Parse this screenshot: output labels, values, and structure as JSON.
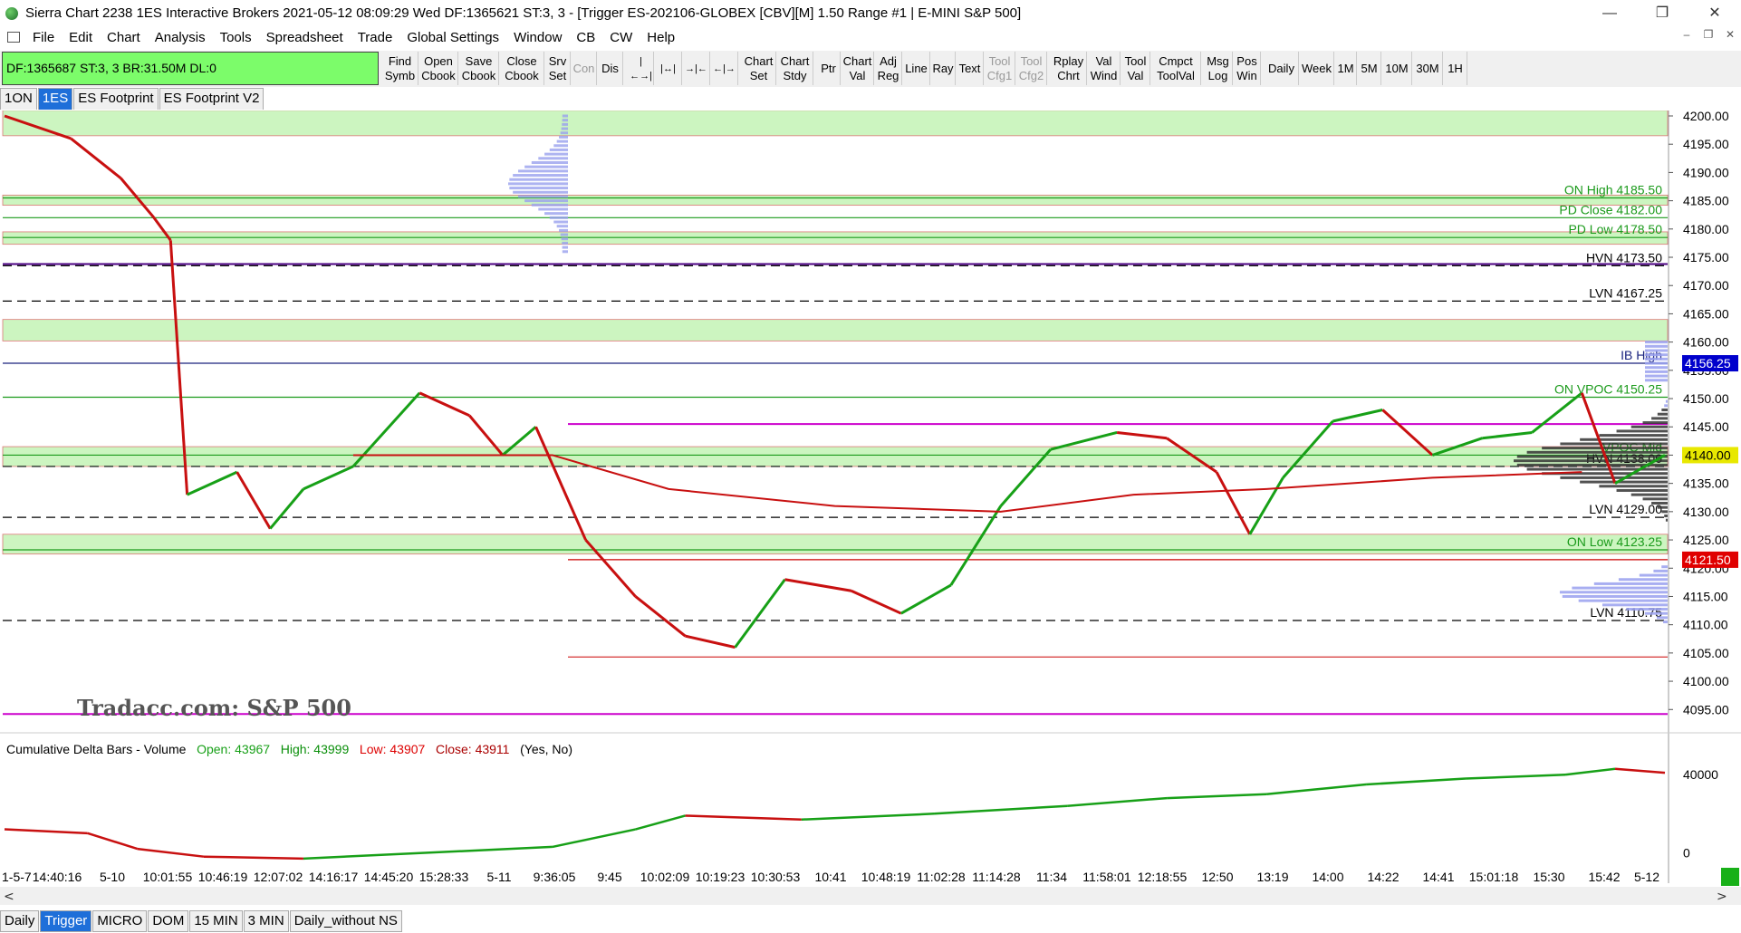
{
  "window": {
    "title": "Sierra Chart 2238 1ES  Interactive Brokers 2021-05-12  08:09:29 Wed  DF:1365621  ST:3, 3 - [Trigger ES-202106-GLOBEX [CBV][M]  1.50 Range  #1 | E-MINI S&P 500]",
    "minimize": "—",
    "restore": "❐",
    "close": "✕"
  },
  "menu": [
    "File",
    "Edit",
    "Chart",
    "Analysis",
    "Tools",
    "Spreadsheet",
    "Trade",
    "Global Settings",
    "Window",
    "CB",
    "CW",
    "Help"
  ],
  "mdi": {
    "minimize": "–",
    "restore": "❐",
    "close": "✕"
  },
  "status": "DF:1365687  ST:3, 3   BR:31.50M  DL:0",
  "toolbar": {
    "find": "Find\nSymb",
    "open": "Open\nCbook",
    "save": "Save\nCbook",
    "close_cb": "Close\nCbook",
    "srv": "Srv\nSet",
    "con": "Con",
    "dis": "Dis",
    "i1": "|←→|",
    "i2": "|↔|",
    "i3": "→|←",
    "i4": "←|→",
    "chart_set": "Chart\nSet",
    "chart_stdy": "Chart\nStdy",
    "ptr": "Ptr",
    "chart_val": "Chart\nVal",
    "adj_reg": "Adj\nReg",
    "line": "Line",
    "ray": "Ray",
    "text": "Text",
    "tool_cfg1": "Tool\nCfg1",
    "tool_cfg2": "Tool\nCfg2",
    "rplay": "Rplay\nChrt",
    "val_wind": "Val\nWind",
    "tool_val": "Tool\nVal",
    "cmpct": "Cmpct\nToolVal",
    "msg": "Msg\nLog",
    "pos": "Pos\nWin",
    "daily": "Daily",
    "week": "Week",
    "m1": "1M",
    "m5": "5M",
    "m10": "10M",
    "m30": "30M",
    "h1": "1H"
  },
  "chart_tabs": [
    "1ON",
    "1ES",
    "ES Footprint",
    "ES Footprint V2"
  ],
  "bottom_tabs": [
    "Daily",
    "Trigger",
    "MICRO",
    "DOM",
    "15 MIN",
    "3 MIN",
    "Daily_without NS"
  ],
  "watermark": "Tradacc.com: S&P 500",
  "delta": {
    "label": "Cumulative Delta Bars - Volume",
    "open": "Open: 43967",
    "high": "High: 43999",
    "low": "Low: 43907",
    "close": "Close: 43911",
    "flags": "(Yes, No)"
  },
  "colors": {
    "green_band": "#ccf5c0",
    "purple": "#cc00cc",
    "red": "#cc0000",
    "navy": "#1a237e",
    "price_bg": "#0000cc",
    "low_bg": "#e00000"
  },
  "chart_data": [
    {
      "type": "line",
      "title": "",
      "price_axis": {
        "ticks": [
          4200,
          4195,
          4190,
          4185,
          4180,
          4175,
          4170,
          4165,
          4160,
          4155,
          4150,
          4145,
          4140,
          4135,
          4130,
          4125,
          4120,
          4115,
          4110,
          4105,
          4100,
          4095
        ],
        "tick_labels": [
          "4200.00",
          "4195.00",
          "4190.00",
          "4185.00",
          "4180.00",
          "4175.00",
          "4170.00",
          "4165.00",
          "4160.00",
          "4155.00",
          "4150.00",
          "4145.00",
          "4140.00",
          "4135.00",
          "4130.00",
          "4125.00",
          "4120.00",
          "4115.00",
          "4110.00",
          "4105.00",
          "4100.00",
          "4095.00"
        ],
        "range": [
          4092,
          4200
        ]
      },
      "levels": [
        {
          "label": "ON High  4185.50",
          "price": 4185.5,
          "color": "#1a9a1a"
        },
        {
          "label": "PD Close  4182.00",
          "price": 4182.0,
          "color": "#1a9a1a"
        },
        {
          "label": "PD Low  4178.50",
          "price": 4178.5,
          "color": "#1a9a1a"
        },
        {
          "label": "HVN  4173.50",
          "price": 4173.5,
          "color": "#000"
        },
        {
          "label": "LVN  4167.25",
          "price": 4167.25,
          "color": "#000"
        },
        {
          "label": "IB High",
          "price": 4156.25,
          "color": "#1a237e"
        },
        {
          "label": "ON VPOC  4150.25",
          "price": 4150.25,
          "color": "#1a9a1a"
        },
        {
          "label": "VPOC Mid",
          "price": 4140.0,
          "color": "#1a9a1a"
        },
        {
          "label": "HVN  4138.00",
          "price": 4138.0,
          "color": "#000"
        },
        {
          "label": "LVN  4129.00",
          "price": 4129.0,
          "color": "#000"
        },
        {
          "label": "ON Low  4123.25",
          "price": 4123.25,
          "color": "#1a9a1a"
        },
        {
          "label": "LVN  4110.75",
          "price": 4110.75,
          "color": "#000"
        }
      ],
      "price_tags": [
        {
          "label": "4156.25",
          "price": 4156.25,
          "color": "#0000cc"
        },
        {
          "label": "4140.00",
          "price": 4140.0,
          "color": "#e8e800"
        },
        {
          "label": "4121.50",
          "price": 4121.5,
          "color": "#e00000"
        }
      ],
      "price_path": [
        {
          "t": 0.0,
          "p": 4200
        },
        {
          "t": 0.04,
          "p": 4196
        },
        {
          "t": 0.07,
          "p": 4189
        },
        {
          "t": 0.09,
          "p": 4182
        },
        {
          "t": 0.1,
          "p": 4178
        },
        {
          "t": 0.11,
          "p": 4133
        },
        {
          "t": 0.14,
          "p": 4137
        },
        {
          "t": 0.16,
          "p": 4127
        },
        {
          "t": 0.18,
          "p": 4134
        },
        {
          "t": 0.21,
          "p": 4138
        },
        {
          "t": 0.25,
          "p": 4151
        },
        {
          "t": 0.28,
          "p": 4147
        },
        {
          "t": 0.3,
          "p": 4140
        },
        {
          "t": 0.32,
          "p": 4145
        },
        {
          "t": 0.35,
          "p": 4125
        },
        {
          "t": 0.38,
          "p": 4115
        },
        {
          "t": 0.41,
          "p": 4108
        },
        {
          "t": 0.44,
          "p": 4106
        },
        {
          "t": 0.47,
          "p": 4118
        },
        {
          "t": 0.51,
          "p": 4116
        },
        {
          "t": 0.54,
          "p": 4112
        },
        {
          "t": 0.57,
          "p": 4117
        },
        {
          "t": 0.6,
          "p": 4131
        },
        {
          "t": 0.63,
          "p": 4141
        },
        {
          "t": 0.67,
          "p": 4144
        },
        {
          "t": 0.7,
          "p": 4143
        },
        {
          "t": 0.73,
          "p": 4137
        },
        {
          "t": 0.75,
          "p": 4126
        },
        {
          "t": 0.77,
          "p": 4136
        },
        {
          "t": 0.8,
          "p": 4146
        },
        {
          "t": 0.83,
          "p": 4148
        },
        {
          "t": 0.86,
          "p": 4140
        },
        {
          "t": 0.89,
          "p": 4143
        },
        {
          "t": 0.92,
          "p": 4144
        },
        {
          "t": 0.95,
          "p": 4151
        },
        {
          "t": 0.97,
          "p": 4135
        },
        {
          "t": 1.0,
          "p": 4140
        }
      ],
      "vwap": [
        {
          "t": 0.21,
          "p": 4140
        },
        {
          "t": 0.27,
          "p": 4140
        },
        {
          "t": 0.33,
          "p": 4140
        },
        {
          "t": 0.4,
          "p": 4134
        },
        {
          "t": 0.5,
          "p": 4131
        },
        {
          "t": 0.6,
          "p": 4130
        },
        {
          "t": 0.68,
          "p": 4133
        },
        {
          "t": 0.76,
          "p": 4134
        },
        {
          "t": 0.86,
          "p": 4136
        },
        {
          "t": 0.95,
          "p": 4137
        }
      ]
    },
    {
      "type": "line",
      "title": "Cumulative Delta Bars - Volume",
      "y_ticks": [
        40000,
        0
      ],
      "y_tick_labels": [
        "40000",
        "0"
      ],
      "range": [
        -4000,
        48000
      ],
      "path": [
        {
          "t": 0.0,
          "v": 12000
        },
        {
          "t": 0.05,
          "v": 10000
        },
        {
          "t": 0.08,
          "v": 2000
        },
        {
          "t": 0.12,
          "v": -2000
        },
        {
          "t": 0.18,
          "v": -3000
        },
        {
          "t": 0.33,
          "v": 3000
        },
        {
          "t": 0.38,
          "v": 12000
        },
        {
          "t": 0.41,
          "v": 19000
        },
        {
          "t": 0.48,
          "v": 17000
        },
        {
          "t": 0.56,
          "v": 20000
        },
        {
          "t": 0.64,
          "v": 24000
        },
        {
          "t": 0.7,
          "v": 28000
        },
        {
          "t": 0.76,
          "v": 30000
        },
        {
          "t": 0.82,
          "v": 35000
        },
        {
          "t": 0.88,
          "v": 38000
        },
        {
          "t": 0.94,
          "v": 40000
        },
        {
          "t": 0.97,
          "v": 43000
        },
        {
          "t": 1.0,
          "v": 41000
        }
      ]
    }
  ],
  "time_axis": [
    "1-5-7",
    "14:40:16",
    "5-10",
    "10:01:55",
    "10:46:19",
    "12:07:02",
    "14:16:17",
    "14:45:20",
    "15:28:33",
    "5-11",
    "9:36:05",
    "9:45",
    "10:02:09",
    "10:19:23",
    "10:30:53",
    "10:41",
    "10:48:19",
    "11:02:28",
    "11:14:28",
    "11:34",
    "11:58:01",
    "12:18:55",
    "12:50",
    "13:19",
    "14:00",
    "14:22",
    "14:41",
    "15:01:18",
    "15:30",
    "15:42",
    "5-12"
  ]
}
